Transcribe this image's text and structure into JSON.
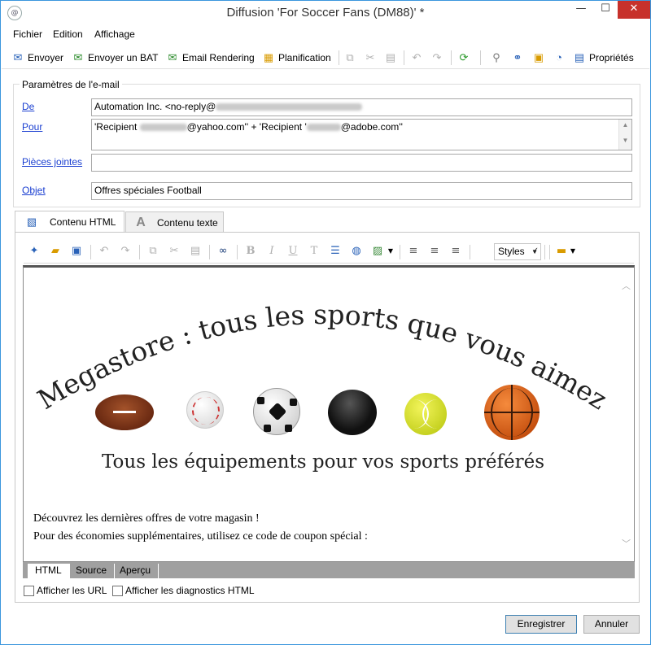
{
  "window": {
    "title": "Diffusion 'For Soccer Fans (DM88)' *",
    "minimize": "—",
    "maximize": "☐",
    "close": "✕"
  },
  "menu": [
    "Fichier",
    "Edition",
    "Affichage"
  ],
  "toolbar": {
    "send": "Envoyer",
    "send_proof": "Envoyer un BAT",
    "email_rendering": "Email Rendering",
    "planning": "Planification",
    "properties": "Propriétés"
  },
  "params": {
    "group_title": "Paramètres de l'e-mail",
    "from_label": "De",
    "from_value_prefix": "Automation Inc. <no-reply@",
    "to_label": "Pour",
    "to_part1": "'Recipient ",
    "to_part2": "@yahoo.com'' + 'Recipient '",
    "to_part3": "@adobe.com''",
    "attachments_label": "Pièces jointes",
    "attachments_value": "",
    "subject_label": "Objet",
    "subject_value": "Offres spéciales Football"
  },
  "tabs": {
    "html": "Contenu HTML",
    "text": "Contenu texte"
  },
  "editor": {
    "styles": "Styles",
    "headline": "Megastore : tous les sports que vous aimez",
    "subheadline": "Tous les équipements pour vos sports préférés",
    "line1": "Découvrez les dernières offres de votre magasin !",
    "line2": "Pour des économies supplémentaires, utilisez ce code de coupon spécial :"
  },
  "view_tabs": [
    "HTML",
    "Source",
    "Aperçu"
  ],
  "options": {
    "show_urls": "Afficher les URL",
    "show_diagnostics": "Afficher les diagnostics HTML"
  },
  "buttons": {
    "save": "Enregistrer",
    "cancel": "Annuler"
  }
}
